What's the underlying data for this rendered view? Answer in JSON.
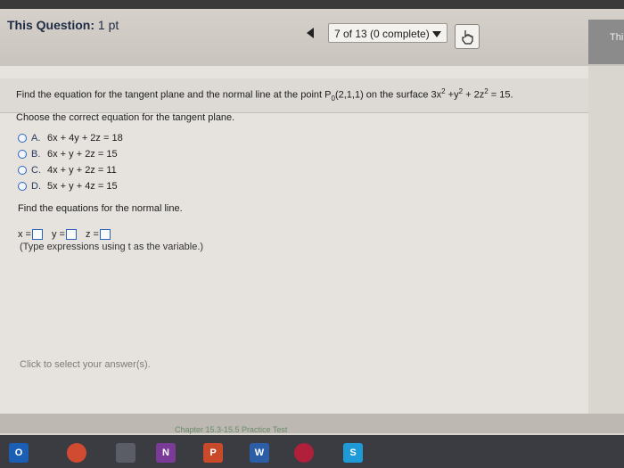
{
  "header": {
    "question_label": "This Question:",
    "points": "1 pt",
    "progress_select": "7 of 13 (0 complete)",
    "right_panel_text": "Thi"
  },
  "question": {
    "prompt_pre": "Find the equation for the tangent plane and the normal line at the point P",
    "prompt_sub": "0",
    "prompt_point": "(2,1,1) on the surface 3x",
    "prompt_exp1": "2",
    "prompt_y": " +y",
    "prompt_exp2": "2",
    "prompt_z": " + 2z",
    "prompt_exp3": "2",
    "prompt_end": " = 15.",
    "tangent_prompt": "Choose the correct equation for the tangent plane.",
    "options": [
      {
        "letter": "A.",
        "text": "6x + 4y + 2z = 18"
      },
      {
        "letter": "B.",
        "text": "6x + y + 2z = 15"
      },
      {
        "letter": "C.",
        "text": "4x + y + 2z = 11"
      },
      {
        "letter": "D.",
        "text": "5x + y + 4z = 15"
      }
    ],
    "normal_prompt": "Find the equations for the normal line.",
    "x_label": "x =",
    "y_label": "y =",
    "z_label": "z =",
    "hint": "(Type expressions using t as the variable.)",
    "click_hint": "Click to select your answer(s)."
  },
  "footer": {
    "link_text": "Chapter 15.3-15.5 Practice Test"
  },
  "taskbar": {
    "icons": [
      {
        "name": "outlook",
        "glyph": "O",
        "color": "#1a5fb4"
      },
      {
        "name": "chrome",
        "glyph": "",
        "color": "#d14b32"
      },
      {
        "name": "blank",
        "glyph": "",
        "color": "#5a5d66"
      },
      {
        "name": "onenote",
        "glyph": "N",
        "color": "#7a3b98"
      },
      {
        "name": "powerpoint",
        "glyph": "P",
        "color": "#c84a2a"
      },
      {
        "name": "word",
        "glyph": "W",
        "color": "#2c5ea8"
      },
      {
        "name": "pearson",
        "glyph": "",
        "color": "#b0203a"
      },
      {
        "name": "skype",
        "glyph": "S",
        "color": "#1e9ad6"
      }
    ]
  }
}
